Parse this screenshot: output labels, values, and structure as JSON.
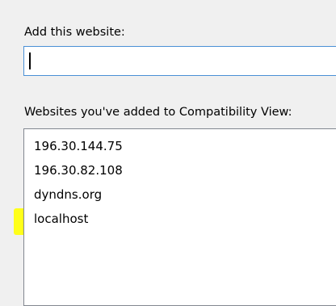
{
  "add_section": {
    "label": "Add this website:",
    "input_value": ""
  },
  "list_section": {
    "label": "Websites you've added to Compatibility View:",
    "items": [
      {
        "text": "196.30.144.75"
      },
      {
        "text": "196.30.82.108"
      },
      {
        "text": "dyndns.org"
      },
      {
        "text": "localhost"
      }
    ],
    "highlighted_item": "localhost",
    "highlight_color": "#ffff1a"
  }
}
